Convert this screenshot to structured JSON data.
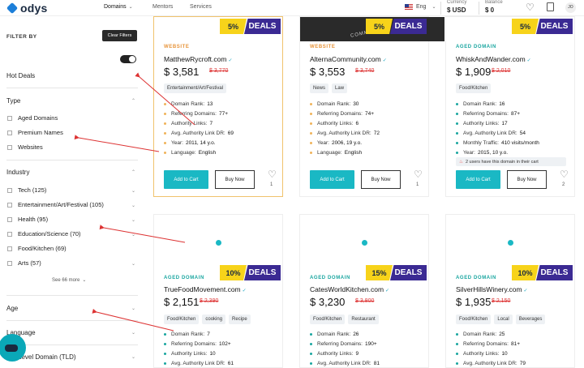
{
  "header": {
    "logo": "odys",
    "nav": [
      {
        "label": "Domains",
        "active": true,
        "dropdown": true
      },
      {
        "label": "Mentors"
      },
      {
        "label": "Services"
      }
    ],
    "language": "Eng",
    "currency_label": "Currency",
    "currency_value": "$ USD",
    "balance_label": "Balance",
    "balance_value": "$ 0",
    "avatar": "JO"
  },
  "sidebar": {
    "filter_by": "FILTER BY",
    "clear_filters": "Clear Filters",
    "hot_deals": "Hot Deals",
    "hot_deals_on": true,
    "type_title": "Type",
    "type_options": [
      "Aged Domains",
      "Premium Names",
      "Websites"
    ],
    "industry_title": "Industry",
    "industry_options": [
      "Tech (125)",
      "Entertainment/Art/Festival (105)",
      "Health (95)",
      "Education/Science (70)",
      "Food/Kitchen (69)",
      "Arts (57)"
    ],
    "see_more": "See 66 more",
    "age_title": "Age",
    "language_title": "Language",
    "tld_title": "Level Domain (TLD)"
  },
  "cards": [
    {
      "category": "WEBSITE",
      "deal_pct": "5%",
      "deal_label": "DEALS",
      "domain": "MatthewRycroft.com",
      "price": "$ 3,581",
      "old_price": "$ 3,770",
      "tags": [
        "Entertainment/Art/Festival"
      ],
      "attrs": [
        [
          "Domain Rank:",
          "13"
        ],
        [
          "Referring Domains:",
          "77+"
        ],
        [
          "Authority Links:",
          "7"
        ],
        [
          "Avg. Authority Link DR:",
          "69"
        ],
        [
          "Year:",
          "2011, 14 y.o."
        ],
        [
          "Language:",
          "English"
        ]
      ],
      "add_to_cart": "Add to Cart",
      "buy_now": "Buy Now",
      "likes": "1"
    },
    {
      "category": "WEBSITE",
      "deal_pct": "5%",
      "deal_label": "DEALS",
      "domain": "AlternaCommunity.com",
      "price": "$ 3,553",
      "old_price": "$ 3,740",
      "tags": [
        "News",
        "Law"
      ],
      "attrs": [
        [
          "Domain Rank:",
          "30"
        ],
        [
          "Referring Domains:",
          "74+"
        ],
        [
          "Authority Links:",
          "6"
        ],
        [
          "Avg. Authority Link DR:",
          "72"
        ],
        [
          "Year:",
          "2006, 19 y.o."
        ],
        [
          "Language:",
          "English"
        ]
      ],
      "add_to_cart": "Add to Cart",
      "buy_now": "Buy Now",
      "likes": "1",
      "hero_text": "COMMU"
    },
    {
      "category": "AGED DOMAIN",
      "deal_pct": "5%",
      "deal_label": "DEALS",
      "domain": "WhiskAndWander.com",
      "price": "$ 1,909",
      "old_price": "$ 2,010",
      "tags": [
        "Food/Kitchen"
      ],
      "attrs": [
        [
          "Domain Rank:",
          "16"
        ],
        [
          "Referring Domains:",
          "87+"
        ],
        [
          "Authority Links:",
          "17"
        ],
        [
          "Avg. Authority Link DR:",
          "54"
        ],
        [
          "Monthly Traffic:",
          "410 visits/month"
        ],
        [
          "Year:",
          "2015, 10 y.o."
        ]
      ],
      "alert": "2 users have this domain in their cart",
      "add_to_cart": "Add to Cart",
      "buy_now": "Buy Now",
      "likes": "2"
    },
    {
      "category": "AGED DOMAIN",
      "deal_pct": "10%",
      "deal_label": "DEALS",
      "domain": "TrueFoodMovement.com",
      "price": "$ 2,151",
      "old_price": "$ 2,390",
      "tags": [
        "Food/Kitchen",
        "cooking",
        "Recipe"
      ],
      "attrs": [
        [
          "Domain Rank:",
          "7"
        ],
        [
          "Referring Domains:",
          "102+"
        ],
        [
          "Authority Links:",
          "10"
        ],
        [
          "Avg. Authority Link DR:",
          "61"
        ]
      ]
    },
    {
      "category": "AGED DOMAIN",
      "deal_pct": "15%",
      "deal_label": "DEALS",
      "domain": "CatesWorldKitchen.com",
      "price": "$ 3,230",
      "old_price": "$ 3,800",
      "tags": [
        "Food/Kitchen",
        "Restaurant"
      ],
      "attrs": [
        [
          "Domain Rank:",
          "26"
        ],
        [
          "Referring Domains:",
          "190+"
        ],
        [
          "Authority Links:",
          "9"
        ],
        [
          "Avg. Authority Link DR:",
          "81"
        ]
      ]
    },
    {
      "category": "AGED DOMAIN",
      "deal_pct": "10%",
      "deal_label": "DEALS",
      "domain": "SilverHillsWinery.com",
      "price": "$ 1,935",
      "old_price": "$ 2,150",
      "tags": [
        "Food/Kitchen",
        "Local",
        "Beverages"
      ],
      "attrs": [
        [
          "Domain Rank:",
          "25"
        ],
        [
          "Referring Domains:",
          "81+"
        ],
        [
          "Authority Links:",
          "10"
        ],
        [
          "Avg. Authority Link DR:",
          "79"
        ]
      ]
    }
  ],
  "colors": {
    "accent": "#1ab8c4",
    "deal_yellow": "#f7d31a",
    "deal_purple": "#3b2a93",
    "old_price": "#dd3333",
    "website": "#e7943a",
    "aged": "#1aa6a0"
  }
}
